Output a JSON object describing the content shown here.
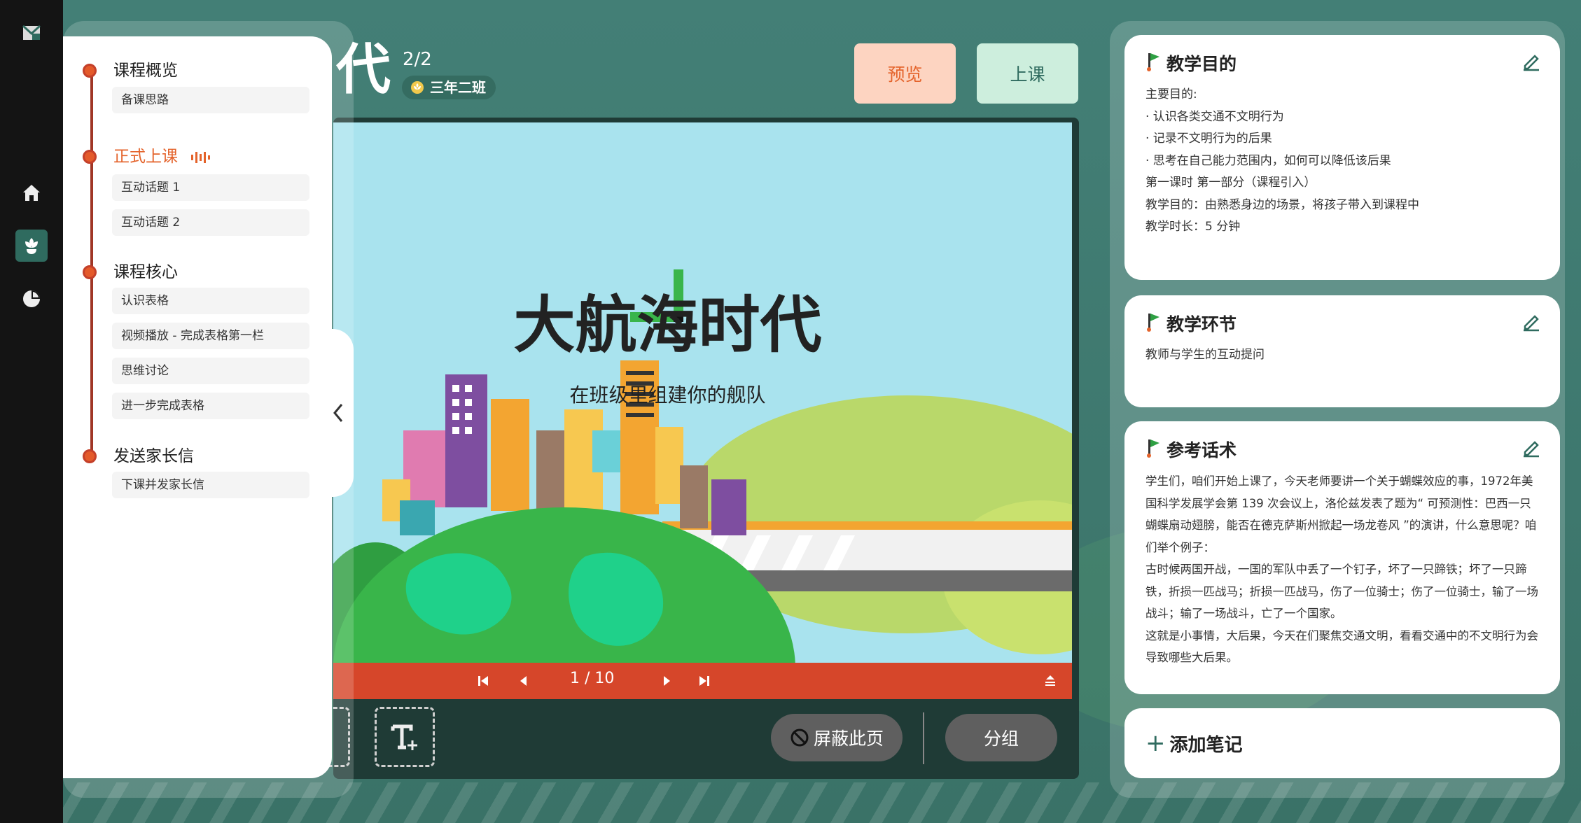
{
  "header": {
    "title_fragment": "代",
    "page_count": "2/2",
    "class_name": "三年二班",
    "preview_label": "预览",
    "start_class_label": "上课"
  },
  "outline": {
    "sections": [
      {
        "title": "课程概览",
        "active": false,
        "items": [
          "备课思路"
        ]
      },
      {
        "title": "正式上课",
        "active": true,
        "items": [
          "互动话题 1",
          "互动话题 2"
        ]
      },
      {
        "title": "课程核心",
        "active": false,
        "items": [
          "认识表格",
          "视频播放 - 完成表格第一栏",
          "思维讨论",
          "进一步完成表格"
        ]
      },
      {
        "title": "发送家长信",
        "active": false,
        "items": [
          "下课并发家长信"
        ]
      }
    ]
  },
  "slide": {
    "title": "大航海时代",
    "subtitle": "在班级里组建你的舰队",
    "page_indicator": "1 / 10"
  },
  "toolbar": {
    "hide_page_label": "屏蔽此页",
    "group_label": "分组"
  },
  "notes": {
    "goal": {
      "title": "教学目的",
      "lines": [
        "主要目的:",
        "·  认识各类交通不文明行为",
        "·  记录不文明行为的后果",
        "·  思考在自己能力范围内，如何可以降低该后果",
        "第一课时 第一部分（课程引入）",
        "教学目的：由熟悉身边的场景，将孩子带入到课程中",
        "教学时长：5 分钟"
      ]
    },
    "steps": {
      "title": "教学环节",
      "lines": [
        "教师与学生的互动提问"
      ]
    },
    "script": {
      "title": "参考话术",
      "paragraphs": [
        "学生们，咱们开始上课了，今天老师要讲一个关于蝴蝶效应的事，1972年美国科学发展学会第 139 次会议上，洛伦兹发表了题为“ 可预测性：巴西一只蝴蝶扇动翅膀，能否在德克萨斯州掀起一场龙卷风 ”的演讲，什么意思呢？咱们举个例子：",
        "古时候两国开战，一国的军队中丢了一个钉子，坏了一只蹄铁；坏了一只蹄铁，折损一匹战马；折损一匹战马，伤了一位骑士；伤了一位骑士，输了一场战斗；输了一场战斗，亡了一个国家。",
        "这就是小事情，大后果，今天在们聚焦交通文明，看看交通中的不文明行为会导致哪些大后果。"
      ]
    },
    "add_note_label": "添加笔记"
  },
  "colors": {
    "accent_orange": "#e4632b",
    "brand_green": "#2f6b5f",
    "control_bar": "#d6462a"
  }
}
